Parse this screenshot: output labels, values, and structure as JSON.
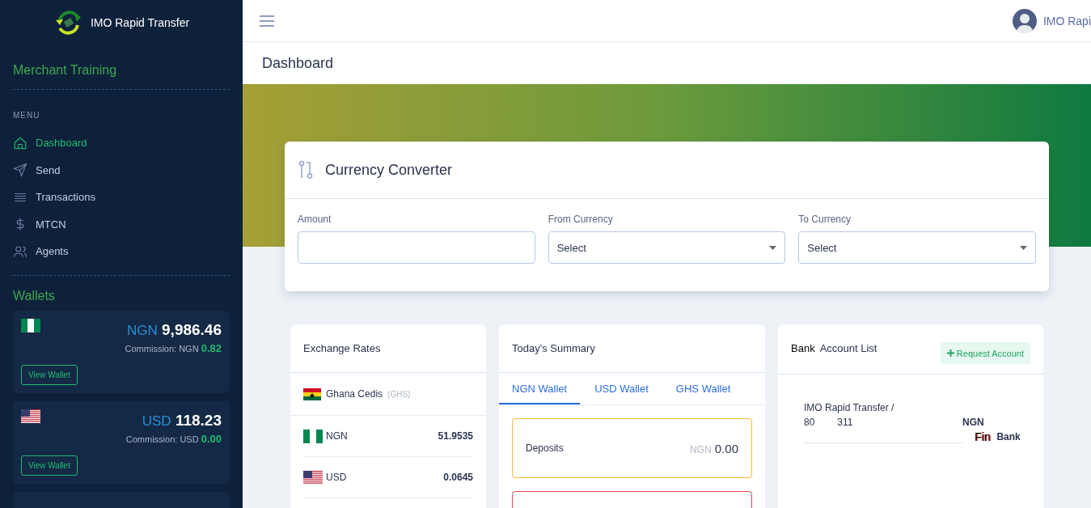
{
  "brand": {
    "name": "IMO Rapid Transfer"
  },
  "sidebar": {
    "account_name": "Merchant Training",
    "menu_heading": "MENU",
    "items": [
      {
        "label": "Dashboard",
        "selected": true
      },
      {
        "label": "Send",
        "selected": false
      },
      {
        "label": "Transactions",
        "selected": false
      },
      {
        "label": "MTCN",
        "selected": false
      },
      {
        "label": "Agents",
        "selected": false
      }
    ],
    "wallets_heading": "Wallets",
    "wallets": [
      {
        "kind": "nigeria",
        "currency": "NGN",
        "balance": "9,986.46",
        "commission_label": "Commission: NGN",
        "commission": "0.82",
        "button": "View Wallet"
      },
      {
        "kind": "usa",
        "currency": "USD",
        "balance": "118.23",
        "commission_label": "Commission: USD",
        "commission": "0.00",
        "button": "View Wallet"
      }
    ]
  },
  "topbar": {
    "user_name": "IMO Rapi"
  },
  "page_title": "Dashboard",
  "converter": {
    "title": "Currency Converter",
    "fields": [
      {
        "kind": "input",
        "label": "Amount"
      },
      {
        "kind": "select",
        "label": "From Currency",
        "value": "Select"
      },
      {
        "kind": "select",
        "label": "To Currency",
        "value": "Select"
      }
    ]
  },
  "exchange_rates": {
    "title": "Exchange Rates",
    "base": {
      "kind": "ghana",
      "name": "Ghana Cedis",
      "code": "(GHS)"
    },
    "rows": [
      {
        "kind": "nigeria",
        "code": "NGN",
        "rate": "51.9535"
      },
      {
        "kind": "usa",
        "code": "USD",
        "rate": "0.0645"
      }
    ]
  },
  "summary": {
    "title": "Today's Summary",
    "tabs": [
      {
        "label": "NGN Wallet",
        "selected": true
      },
      {
        "label": "USD Wallet",
        "selected": false
      },
      {
        "label": "GHS Wallet",
        "selected": false
      }
    ],
    "items": [
      {
        "label": "Deposits",
        "currency": "NGN",
        "amount": "0.00",
        "color": "#f6bb33"
      },
      {
        "color": "#e6405a"
      }
    ]
  },
  "accounts": {
    "title_prefix": "Bank",
    "title": "Account List",
    "button": "Request Account",
    "rows": [
      {
        "name": "IMO Rapid Transfer /",
        "number_start": "80",
        "number_end": "311",
        "currency": "NGN",
        "logo_text": "Fin",
        "bank": "Bank"
      }
    ]
  }
}
